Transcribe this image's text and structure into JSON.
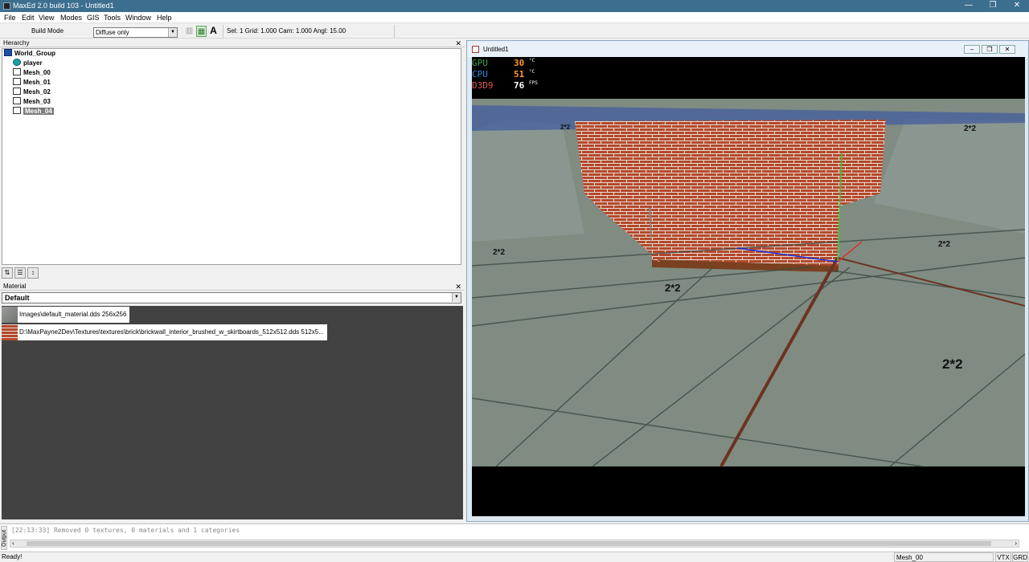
{
  "window": {
    "title": "MaxEd 2.0 build 103 - Untitled1",
    "minimize": "—",
    "restore": "❐",
    "close": "✕"
  },
  "menu": [
    "File",
    "Edit",
    "View",
    "Modes",
    "GIS",
    "Tools",
    "Window",
    "Help"
  ],
  "toolbar": {
    "mode_label": "Build Mode",
    "render_select": "Diffuse only",
    "status": "Sel: 1  Grid: 1.000  Cam: 1.000  Angl: 15.00"
  },
  "hierarchy": {
    "title": "Herarchy",
    "items": [
      {
        "label": "World_Group",
        "icon": "world-group-icon"
      },
      {
        "label": "player",
        "icon": "player-icon"
      },
      {
        "label": "Mesh_00",
        "icon": "mesh-icon"
      },
      {
        "label": "Mesh_01",
        "icon": "mesh-icon"
      },
      {
        "label": "Mesh_02",
        "icon": "mesh-icon"
      },
      {
        "label": "Mesh_03",
        "icon": "mesh-icon"
      },
      {
        "label": "Mesh_04",
        "icon": "mesh-icon",
        "selected": true
      }
    ]
  },
  "material": {
    "title": "Material",
    "selected": "Default",
    "items": [
      "Images\\default_material.dds 256x256",
      "D:\\MaxPayne2Dev\\Textures\\textures\\brick\\brickwall_interior_brushed_w_skirtboards_512x512.dds 512x5..."
    ]
  },
  "viewport": {
    "title": "Untitled1",
    "hud": [
      {
        "name": "GPU",
        "value": "30",
        "unit": "°C",
        "color": "#3aa84a"
      },
      {
        "name": "CPU",
        "value": "51",
        "unit": "°C",
        "color": "#2e86de"
      },
      {
        "name": "D3D9",
        "value": "76",
        "unit": "FPS",
        "color": "#e05555"
      }
    ],
    "labels": [
      "2*2",
      "2*2",
      "2*2",
      "2*2",
      "2*2",
      "2*2"
    ]
  },
  "output": {
    "tab": "Output",
    "line": "[22:13:33] Removed 0 textures, 0 materials and 1 categories"
  },
  "statusbar": {
    "ready": "Ready!",
    "selection": "Mesh_00",
    "vtx": "VTX",
    "grd": "GRD"
  },
  "colors": {
    "titlebar": "#3c6e8f",
    "brick": "#b5482b",
    "floor": "#7c8a7e",
    "wall_tile": "#8a9690"
  }
}
